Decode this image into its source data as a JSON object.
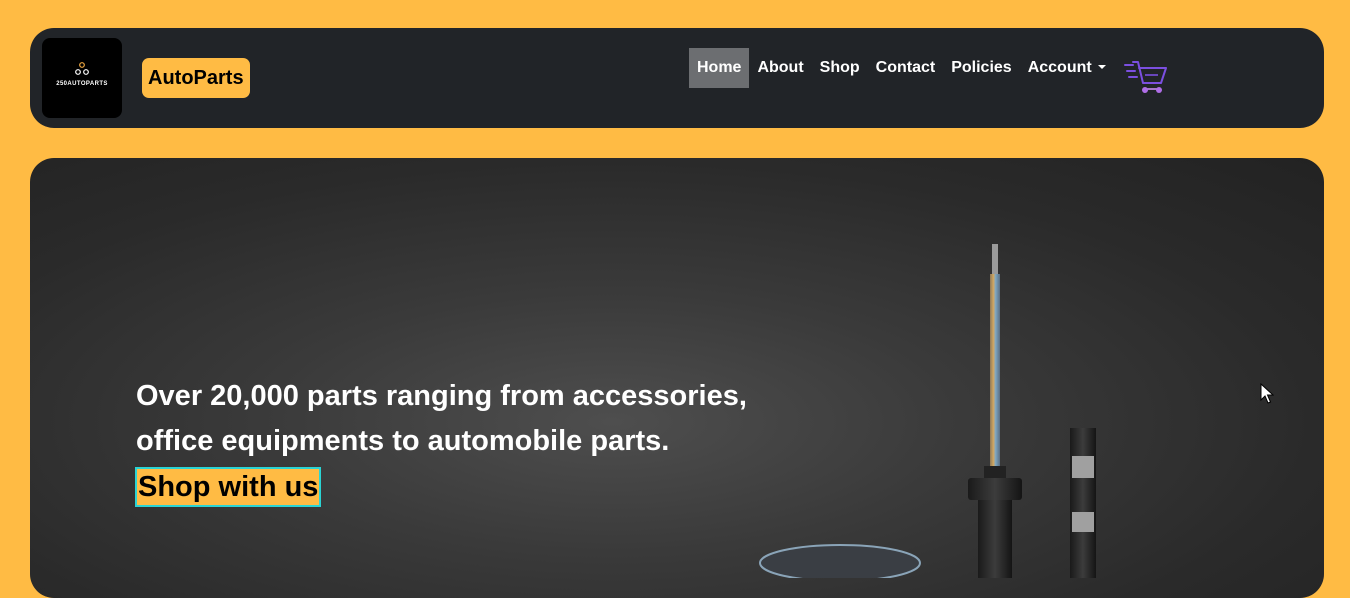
{
  "logo": {
    "text": "250AUTOPARTS"
  },
  "brand": {
    "label": "AutoParts"
  },
  "nav": {
    "items": [
      {
        "label": "Home",
        "active": true
      },
      {
        "label": "About"
      },
      {
        "label": "Shop"
      },
      {
        "label": "Contact"
      },
      {
        "label": "Policies"
      },
      {
        "label": "Account",
        "dropdown": true
      }
    ]
  },
  "cart": {
    "icon": "shopping-cart-icon"
  },
  "hero": {
    "line1": "Over 20,000 parts ranging from accessories,",
    "line2": "office equipments to automobile parts.",
    "cta": "Shop with us"
  },
  "colors": {
    "background": "#ffbb44",
    "navbar": "#212428",
    "active_nav": "#6c6e71",
    "cta_border": "#2ad4d4",
    "cart_primary": "#7b4fe0"
  }
}
